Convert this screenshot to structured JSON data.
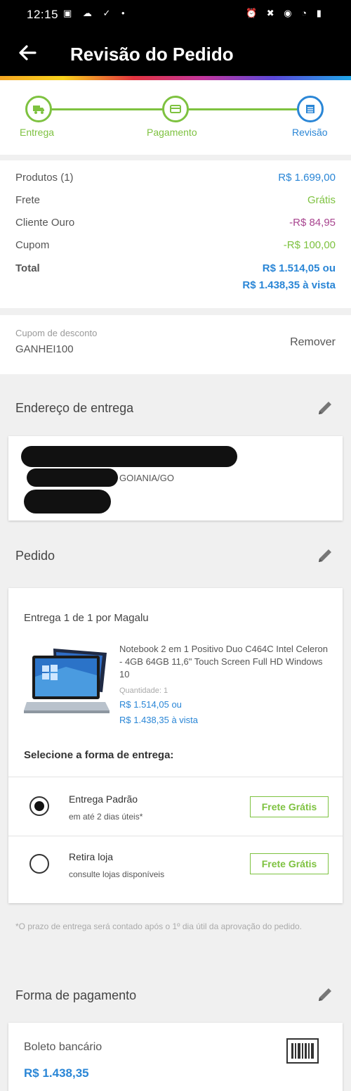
{
  "status_bar": {
    "time": "12:15",
    "left_icons": "▣ ☁ ✓ •",
    "right_icons": "⏰ ✖ ◉ ◔ ▮"
  },
  "app_bar": {
    "title": "Revisão do Pedido",
    "back_icon": "arrow-left-icon"
  },
  "stepper": {
    "steps": [
      {
        "label": "Entrega",
        "icon": "truck-icon",
        "state": "done"
      },
      {
        "label": "Pagamento",
        "icon": "card-icon",
        "state": "done"
      },
      {
        "label": "Revisão",
        "icon": "list-icon",
        "state": "active"
      }
    ],
    "colors": {
      "done": "#7ec240",
      "active": "#2a86d6"
    }
  },
  "summary": {
    "products": {
      "label": "Produtos (1)",
      "value": "R$ 1.699,00"
    },
    "shipping": {
      "label": "Frete",
      "value": "Grátis"
    },
    "gold_client": {
      "label": "Cliente Ouro",
      "value": "-R$ 84,95"
    },
    "coupon": {
      "label": "Cupom",
      "value": "-R$ 100,00"
    },
    "total": {
      "label": "Total",
      "value_installments": "R$ 1.514,05 ou",
      "value_cash": "R$ 1.438,35 à vista"
    }
  },
  "discount_coupon": {
    "caption": "Cupom de desconto",
    "code": "GANHEI100",
    "remove_label": "Remover"
  },
  "address": {
    "title": "Endereço de entrega",
    "city": "GOIANIA/GO"
  },
  "order": {
    "title": "Pedido",
    "delivery_caption": "Entrega 1 de 1 por Magalu",
    "product": {
      "name": "Notebook 2 em 1 Positivo Duo C464C Intel Celeron - 4GB 64GB 11,6\" Touch Screen Full HD Windows 10",
      "quantity": "Quantidade: 1",
      "price_installments": "R$ 1.514,05 ou",
      "price_cash": "R$ 1.438,35 à vista"
    },
    "delivery_heading": "Selecione a forma de entrega:",
    "options": [
      {
        "title": "Entrega Padrão",
        "subtitle": "em até 2 dias úteis*",
        "badge": "Frete Grátis",
        "selected": true
      },
      {
        "title": "Retira loja",
        "subtitle": "consulte lojas disponíveis",
        "badge": "Frete Grátis",
        "selected": false
      }
    ]
  },
  "footnote": "*O prazo de entrega será contado após o 1º dia útil da aprovação do pedido.",
  "payment": {
    "title": "Forma de pagamento",
    "method": "Boleto bancário",
    "amount": "R$ 1.438,35",
    "icon": "barcode-icon"
  }
}
